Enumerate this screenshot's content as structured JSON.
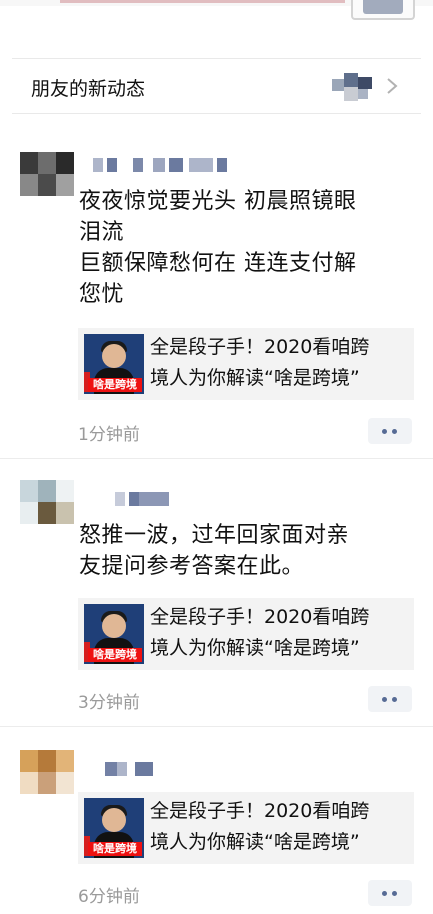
{
  "friends_updates": {
    "label": "朋友的新动态"
  },
  "posts": [
    {
      "content_lines": [
        "夜夜惊觉要光头  初晨照镜眼",
        "泪流",
        "巨额保障愁何在  连连支付解",
        "您忧"
      ],
      "card": {
        "title_lines": [
          "全是段子手！2020看咱跨",
          "境人为你解读“啥是跨境”"
        ],
        "thumb_tag": "啥是跨境"
      },
      "time": "1分钟前"
    },
    {
      "content_lines": [
        "怒推一波，过年回家面对亲",
        "友提问参考答案在此。"
      ],
      "card": {
        "title_lines": [
          "全是段子手！2020看咱跨",
          "境人为你解读“啥是跨境”"
        ],
        "thumb_tag": "啥是跨境"
      },
      "time": "3分钟前"
    },
    {
      "content_lines": [],
      "card": {
        "title_lines": [
          "全是段子手！2020看咱跨",
          "境人为你解读“啥是跨境”"
        ],
        "thumb_tag": "啥是跨境"
      },
      "time": "6分钟前"
    }
  ],
  "colors": {
    "link_blue": "#576b95",
    "time_gray": "#9a9a9a",
    "card_bg": "#f3f3f3"
  }
}
